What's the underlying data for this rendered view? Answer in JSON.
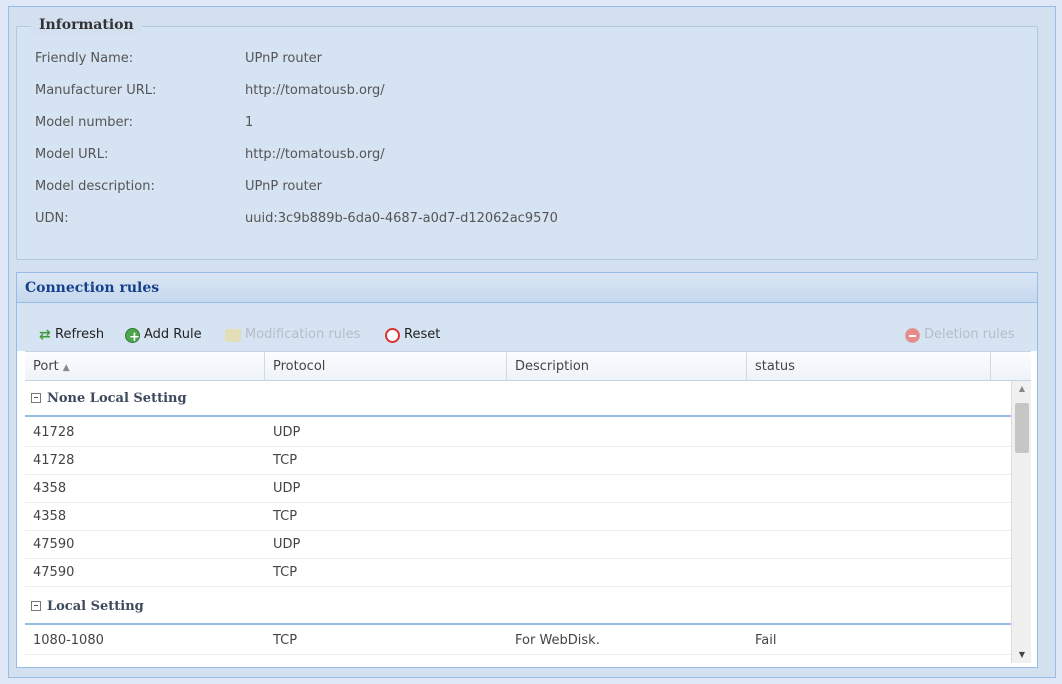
{
  "information": {
    "legend": "Information",
    "rows": [
      {
        "label": "Friendly Name:",
        "value": "UPnP router"
      },
      {
        "label": "Manufacturer URL:",
        "value": "http://tomatousb.org/"
      },
      {
        "label": "Model number:",
        "value": "1"
      },
      {
        "label": "Model URL:",
        "value": "http://tomatousb.org/"
      },
      {
        "label": "Model description:",
        "value": "UPnP router"
      },
      {
        "label": "UDN:",
        "value": "uuid:3c9b889b-6da0-4687-a0d7-d12062ac9570"
      }
    ]
  },
  "connection_rules": {
    "title": "Connection rules",
    "toolbar": {
      "refresh": "Refresh",
      "add_rule": "Add Rule",
      "modification_rules": "Modification rules",
      "reset": "Reset",
      "deletion_rules": "Deletion rules"
    },
    "columns": [
      "Port",
      "Protocol",
      "Description",
      "status"
    ],
    "sort_indicator": "▲",
    "groups": [
      {
        "title": "None Local Setting",
        "rows": [
          {
            "port": "41728",
            "protocol": "UDP",
            "description": "",
            "status": ""
          },
          {
            "port": "41728",
            "protocol": "TCP",
            "description": "",
            "status": ""
          },
          {
            "port": "4358",
            "protocol": "UDP",
            "description": "",
            "status": ""
          },
          {
            "port": "4358",
            "protocol": "TCP",
            "description": "",
            "status": ""
          },
          {
            "port": "47590",
            "protocol": "UDP",
            "description": "",
            "status": ""
          },
          {
            "port": "47590",
            "protocol": "TCP",
            "description": "",
            "status": ""
          }
        ]
      },
      {
        "title": "Local Setting",
        "rows": [
          {
            "port": "1080-1080",
            "protocol": "TCP",
            "description": "For WebDisk.",
            "status": "Fail"
          }
        ]
      }
    ]
  },
  "colors": {
    "background": "#dfe8f6",
    "panel_border": "#99bbe8",
    "header_text": "#15428b",
    "add_icon": "#4ea64e",
    "reset_icon": "#d93030",
    "disabled_text": "#b5bdc8"
  },
  "icons": [
    "refresh-icon",
    "add-icon",
    "edit-icon",
    "reset-icon",
    "delete-icon",
    "collapse-icon"
  ]
}
